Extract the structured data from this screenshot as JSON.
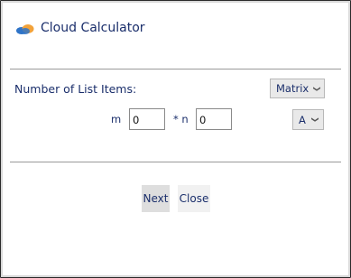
{
  "app": {
    "title": "Cloud Calculator",
    "icon": "cloud-logo-icon"
  },
  "form": {
    "list_items_label": "Number of List Items:",
    "type_select": {
      "value": "Matrix",
      "icon": "chevron-down-icon"
    },
    "m_label": "m",
    "m_value": "0",
    "n_label": "* n",
    "n_value": "0",
    "letter_select": {
      "value": "A",
      "icon": "chevron-down-icon"
    }
  },
  "buttons": {
    "next": "Next",
    "close": "Close"
  },
  "colors": {
    "text": "#1a2e6b",
    "cloud_blue": "#2f74c8",
    "cloud_orange": "#f2a23a"
  }
}
